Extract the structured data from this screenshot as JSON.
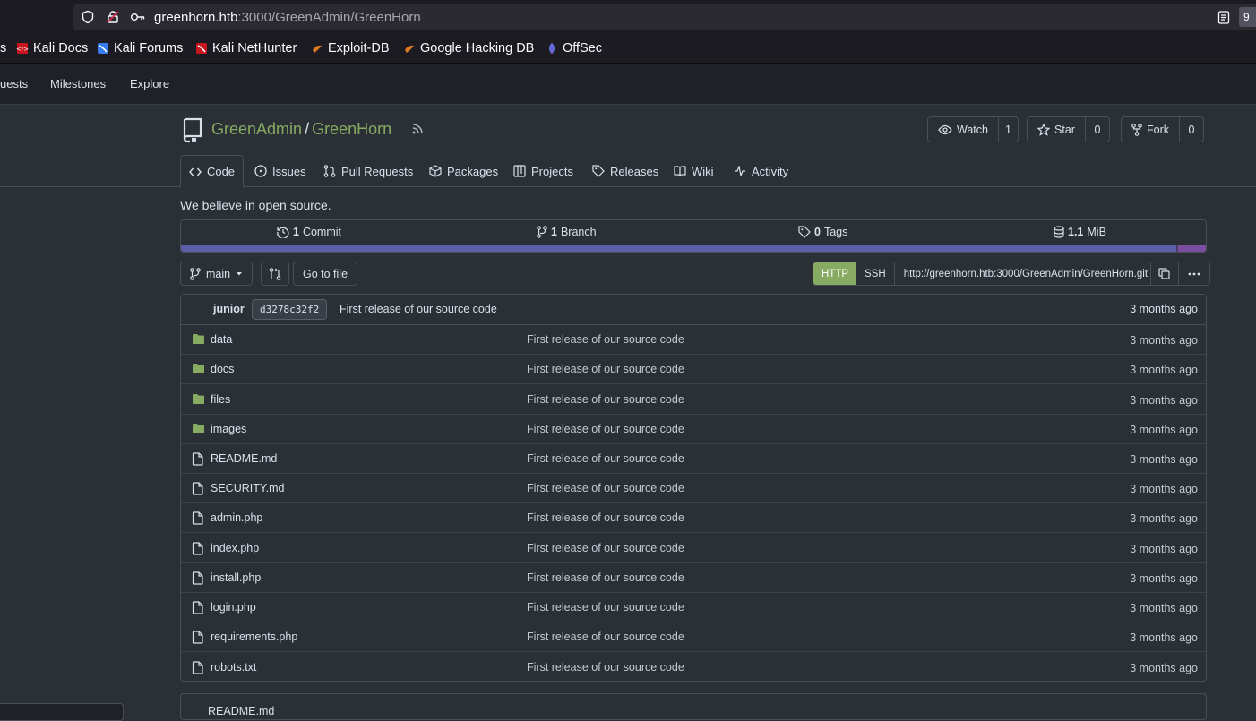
{
  "browser": {
    "url_host": "greenhorn.htb",
    "url_path": ":3000/GreenAdmin/GreenHorn",
    "right_badge": "9",
    "bookmarks": [
      "s",
      "Kali Docs",
      "Kali Forums",
      "Kali NetHunter",
      "Exploit-DB",
      "Google Hacking DB",
      "OffSec"
    ]
  },
  "nav": {
    "items": [
      "uests",
      "Milestones",
      "Explore"
    ]
  },
  "repo": {
    "owner": "GreenAdmin",
    "separator": "/",
    "name": "GreenHorn",
    "watch_label": "Watch",
    "watch_count": "1",
    "star_label": "Star",
    "star_count": "0",
    "fork_label": "Fork",
    "fork_count": "0",
    "tabs": [
      "Code",
      "Issues",
      "Pull Requests",
      "Packages",
      "Projects",
      "Releases",
      "Wiki",
      "Activity"
    ],
    "description": "We believe in open source.",
    "stats": {
      "commits_num": "1",
      "commits_label": "Commit",
      "branches_num": "1",
      "branches_label": "Branch",
      "tags_num": "0",
      "tags_label": "Tags",
      "size_num": "1.1",
      "size_label": "MiB"
    },
    "lang_colors": [
      "#5a5fa8",
      "#4a3a6a",
      "#7b4ea0"
    ],
    "branch": "main",
    "go_to_file": "Go to file",
    "clone": {
      "http": "HTTP",
      "ssh": "SSH",
      "url": "http://greenhorn.htb:3000/GreenAdmin/GreenHorn.git"
    },
    "latest_commit": {
      "author": "junior",
      "sha": "d3278c32f2",
      "message": "First release of our source code",
      "age": "3 months ago"
    },
    "files": [
      {
        "name": "data",
        "type": "dir",
        "msg": "First release of our source code",
        "age": "3 months ago"
      },
      {
        "name": "docs",
        "type": "dir",
        "msg": "First release of our source code",
        "age": "3 months ago"
      },
      {
        "name": "files",
        "type": "dir",
        "msg": "First release of our source code",
        "age": "3 months ago"
      },
      {
        "name": "images",
        "type": "dir",
        "msg": "First release of our source code",
        "age": "3 months ago"
      },
      {
        "name": "README.md",
        "type": "file",
        "msg": "First release of our source code",
        "age": "3 months ago"
      },
      {
        "name": "SECURITY.md",
        "type": "file",
        "msg": "First release of our source code",
        "age": "3 months ago"
      },
      {
        "name": "admin.php",
        "type": "file",
        "msg": "First release of our source code",
        "age": "3 months ago"
      },
      {
        "name": "index.php",
        "type": "file",
        "msg": "First release of our source code",
        "age": "3 months ago"
      },
      {
        "name": "install.php",
        "type": "file",
        "msg": "First release of our source code",
        "age": "3 months ago"
      },
      {
        "name": "login.php",
        "type": "file",
        "msg": "First release of our source code",
        "age": "3 months ago"
      },
      {
        "name": "requirements.php",
        "type": "file",
        "msg": "First release of our source code",
        "age": "3 months ago"
      },
      {
        "name": "robots.txt",
        "type": "file",
        "msg": "First release of our source code",
        "age": "3 months ago"
      }
    ],
    "readme_label": "README.md"
  }
}
